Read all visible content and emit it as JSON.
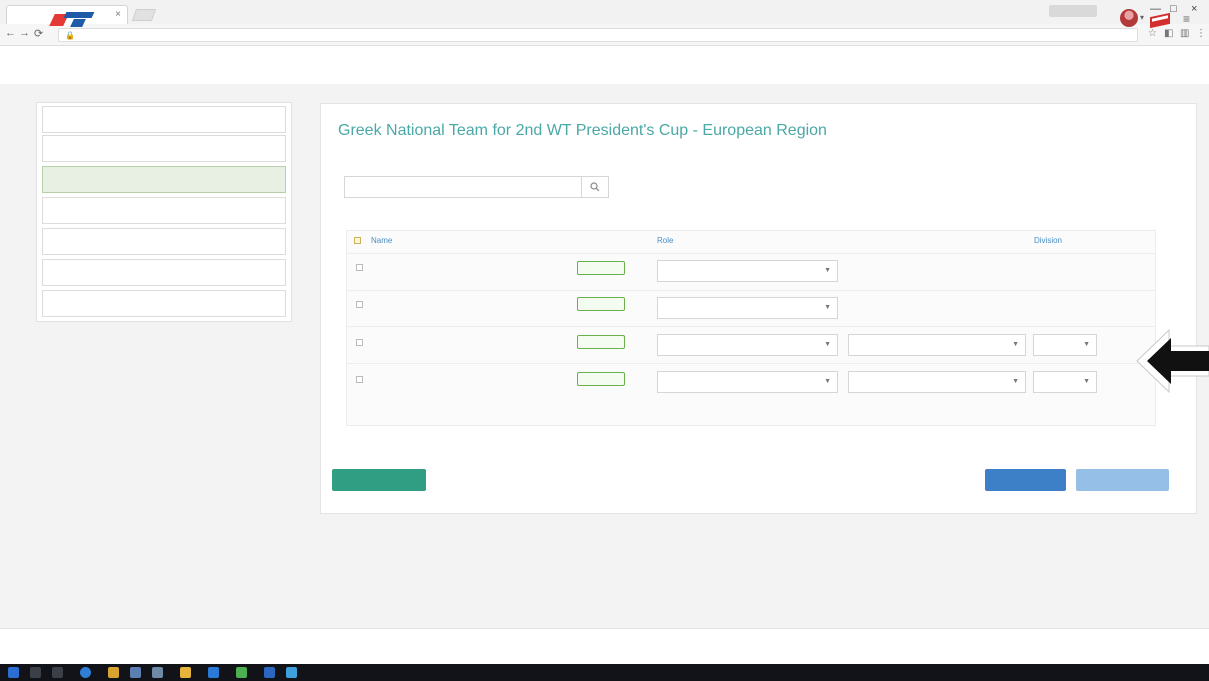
{
  "browser": {
    "tab_title": "",
    "url": ""
  },
  "header": {
    "user_name": ""
  },
  "sidebar": {
    "items": [
      {
        "label": ""
      },
      {
        "label": ""
      },
      {
        "label": "",
        "active": true
      },
      {
        "label": ""
      },
      {
        "label": ""
      },
      {
        "label": ""
      },
      {
        "label": ""
      }
    ]
  },
  "main": {
    "title": "Greek National Team for 2nd WT President's Cup - European Region",
    "search_label": "",
    "search_placeholder": "",
    "columns": {
      "name": "Name",
      "license_status": "",
      "role": "Role",
      "sub_event": "",
      "division": "Division"
    },
    "rows": [
      {
        "name": "",
        "status": "",
        "role": "",
        "sub_event": "",
        "division": ""
      },
      {
        "name": "",
        "status": "",
        "role": "",
        "sub_event": "",
        "division": ""
      },
      {
        "name": "",
        "status": "",
        "role": "",
        "sub_event": "",
        "division": ""
      },
      {
        "name": "",
        "status": "",
        "role": "",
        "sub_event": "",
        "division": ""
      }
    ],
    "buttons": {
      "left": "",
      "next": "",
      "right": ""
    }
  },
  "footer": {
    "logo": "",
    "copyright": ""
  },
  "colors": {
    "title": "#4aa8a6",
    "sidebar_active_bg": "#e7f0e2",
    "status_badge": "#6ab04c",
    "green_button": "#2f9e82",
    "blue_button": "#3d80c8",
    "disabled_button": "#96bfe8"
  }
}
